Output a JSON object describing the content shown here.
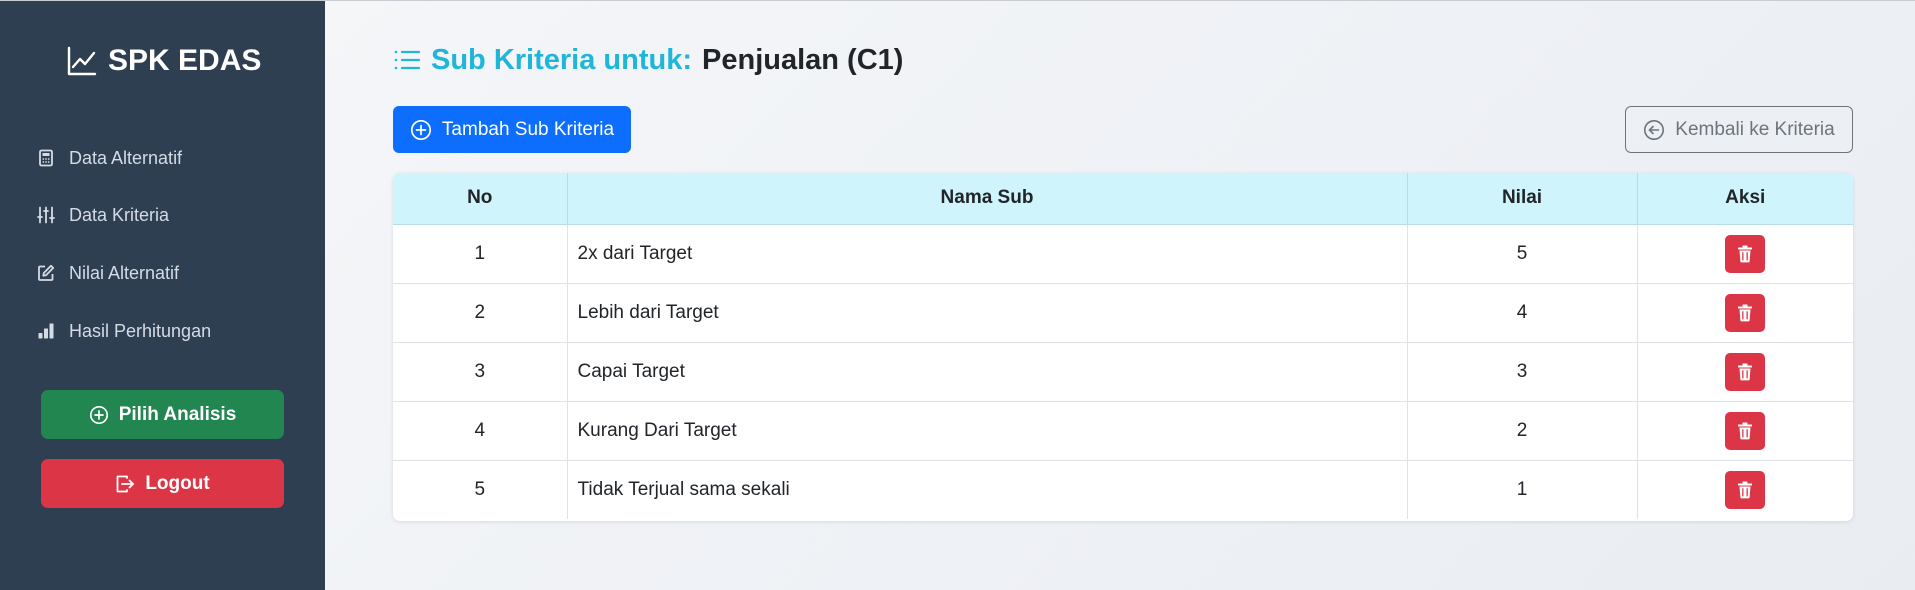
{
  "sidebar": {
    "brand": "SPK EDAS",
    "nav": [
      {
        "label": "Data Alternatif",
        "icon": "calculator-icon"
      },
      {
        "label": "Data Kriteria",
        "icon": "sliders-icon"
      },
      {
        "label": "Nilai Alternatif",
        "icon": "edit-icon"
      },
      {
        "label": "Hasil Perhitungan",
        "icon": "bar-chart-icon"
      }
    ],
    "analysis_label": "Pilih Analisis",
    "logout_label": "Logout"
  },
  "header": {
    "title_prefix": "Sub Kriteria untuk:",
    "title_subject": "Penjualan (C1)"
  },
  "actions": {
    "add_label": "Tambah Sub Kriteria",
    "back_label": "Kembali ke Kriteria"
  },
  "table": {
    "columns": [
      "No",
      "Nama Sub",
      "Nilai",
      "Aksi"
    ],
    "rows": [
      {
        "no": "1",
        "nama": "2x dari Target",
        "nilai": "5"
      },
      {
        "no": "2",
        "nama": "Lebih dari Target",
        "nilai": "4"
      },
      {
        "no": "3",
        "nama": "Capai Target",
        "nilai": "3"
      },
      {
        "no": "4",
        "nama": "Kurang Dari Target",
        "nilai": "2"
      },
      {
        "no": "5",
        "nama": "Tidak Terjual sama sekali",
        "nilai": "1"
      }
    ]
  },
  "colors": {
    "sidebar": "#2f3f52",
    "title_accent": "#1fb6d9",
    "primary": "#0d6efd",
    "success": "#218650",
    "danger": "#dc3545",
    "table_header": "#cff4fc"
  }
}
